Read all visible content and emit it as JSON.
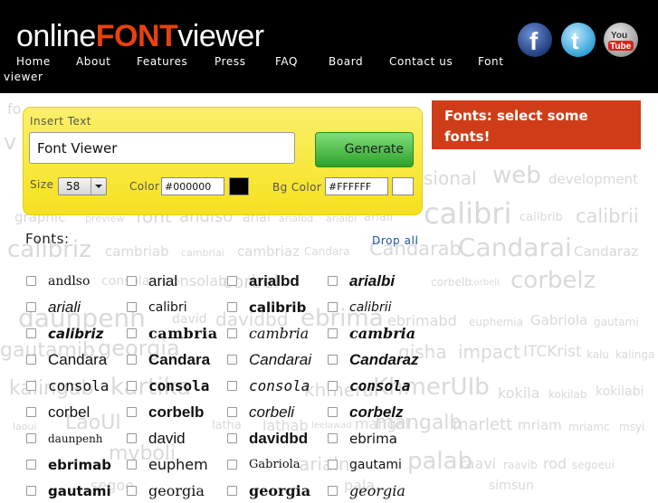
{
  "logo": {
    "part1": "online",
    "part2": "FONT",
    "part3": "viewer"
  },
  "nav": [
    {
      "label": "Home"
    },
    {
      "label": "About"
    },
    {
      "label": "Features"
    },
    {
      "label": "Press"
    },
    {
      "label": "FAQ"
    },
    {
      "label": "Board"
    },
    {
      "label": "Contact us"
    },
    {
      "label": "Font"
    },
    {
      "label": "viewer"
    }
  ],
  "social": {
    "facebook": "f",
    "twitter": "t",
    "youtube_you": "You",
    "youtube_tube": "Tube"
  },
  "panel": {
    "insert_label": "Insert Text",
    "text_value": "Font Viewer",
    "generate_label": "Generate",
    "size_label": "Size",
    "size_value": "58",
    "color_label": "Color",
    "color_value": "#000000",
    "bg_label": "Bg Color",
    "bg_value": "#FFFFFF"
  },
  "banner": {
    "line1": "Fonts: select some",
    "line2": "fonts!"
  },
  "fonts_section": {
    "title": "Fonts:",
    "drop_all": "Drop all"
  },
  "fonts": [
    "andlso",
    "arial",
    "arialbd",
    "arialbi",
    "ariali",
    "calibri",
    "calibrib",
    "calibrii",
    "calibriz",
    "cambria",
    "cambria",
    "cambria",
    "Candara",
    "Candara",
    "Candarai",
    "Candaraz",
    "consola",
    "consola",
    "consola",
    "consola",
    "corbel",
    "corbelb",
    "corbeli",
    "corbelz",
    "daunpenh",
    "david",
    "davidbd",
    "ebrima",
    "ebrimab",
    "euphem",
    "Gabriola",
    "gautami",
    "gautami",
    "georgia",
    "georgia",
    "georgia"
  ],
  "cloud": [
    {
      "t": "fo"
    },
    {
      "t": "v"
    },
    {
      "t": "sional"
    },
    {
      "t": "web"
    },
    {
      "t": "development"
    },
    {
      "t": "graphic"
    },
    {
      "t": "preview"
    },
    {
      "t": "font"
    },
    {
      "t": "andlso"
    },
    {
      "t": "arial"
    },
    {
      "t": "arialbd"
    },
    {
      "t": "arialbi"
    },
    {
      "t": "ariali"
    },
    {
      "t": "calibri"
    },
    {
      "t": "calibrib"
    },
    {
      "t": "calibrii"
    },
    {
      "t": "calibriz"
    },
    {
      "t": "cambriab"
    },
    {
      "t": "cambriai"
    },
    {
      "t": "cambriaz"
    },
    {
      "t": "Candara"
    },
    {
      "t": "Candarab"
    },
    {
      "t": "Candarai"
    },
    {
      "t": "Candaraz"
    },
    {
      "t": "consola"
    },
    {
      "t": "consolab"
    },
    {
      "t": "corbel"
    },
    {
      "t": "corbelb"
    },
    {
      "t": "corbeli"
    },
    {
      "t": "corbelz"
    },
    {
      "t": "daunpenh"
    },
    {
      "t": "david"
    },
    {
      "t": "davidbd"
    },
    {
      "t": "ebrima"
    },
    {
      "t": "ebrimabd"
    },
    {
      "t": "euphemia"
    },
    {
      "t": "Gabriola"
    },
    {
      "t": "gautami"
    },
    {
      "t": "gautamib"
    },
    {
      "t": "georgia"
    },
    {
      "t": "gisha"
    },
    {
      "t": "impact"
    },
    {
      "t": "ITCKrist"
    },
    {
      "t": "kalu"
    },
    {
      "t": "kalinga"
    },
    {
      "t": "kalingab"
    },
    {
      "t": "kartika"
    },
    {
      "t": "khmerui"
    },
    {
      "t": "KhmerUIb"
    },
    {
      "t": "kokila"
    },
    {
      "t": "kokilab"
    },
    {
      "t": "kokilabi"
    },
    {
      "t": "laoui"
    },
    {
      "t": "LaoUI"
    },
    {
      "t": "latha"
    },
    {
      "t": "lathab"
    },
    {
      "t": "leelawad"
    },
    {
      "t": "mangal"
    },
    {
      "t": "mangalb"
    },
    {
      "t": "marlett"
    },
    {
      "t": "mriam"
    },
    {
      "t": "mriamc"
    },
    {
      "t": "msyi"
    },
    {
      "t": "mvboli"
    },
    {
      "t": "arialn"
    },
    {
      "t": "palab"
    },
    {
      "t": "raavi"
    },
    {
      "t": "raavib"
    },
    {
      "t": "rod"
    },
    {
      "t": "segoeui"
    },
    {
      "t": "segoe"
    },
    {
      "t": "pala"
    },
    {
      "t": "simsun"
    }
  ]
}
